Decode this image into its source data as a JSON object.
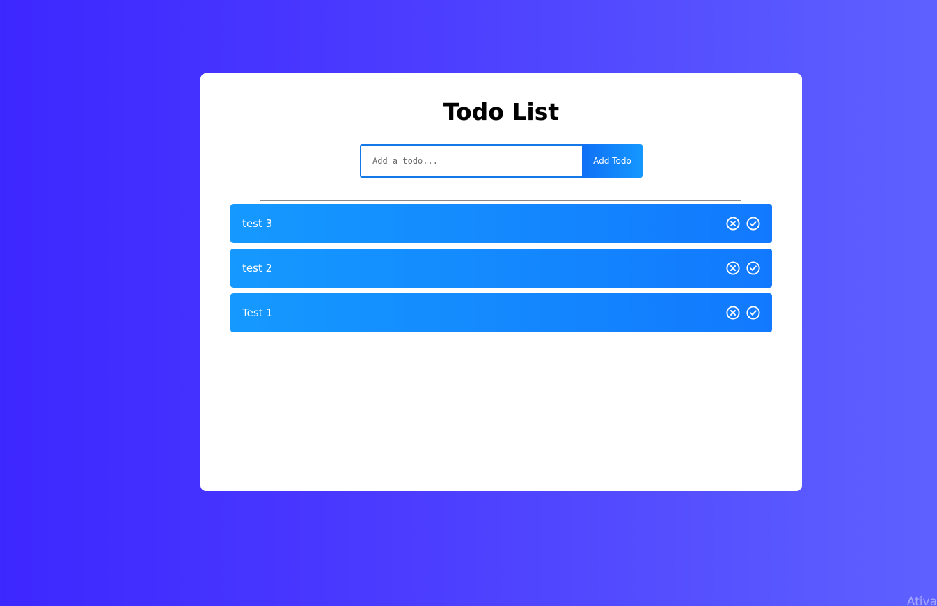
{
  "app": {
    "title": "Todo List"
  },
  "form": {
    "placeholder": "Add a todo...",
    "value": "",
    "button_label": "Add Todo"
  },
  "todos": [
    {
      "text": "test 3",
      "delete_icon": "circle-x-icon",
      "complete_icon": "circle-check-icon"
    },
    {
      "text": "test 2",
      "delete_icon": "circle-x-icon",
      "complete_icon": "circle-check-icon"
    },
    {
      "text": "Test 1",
      "delete_icon": "circle-x-icon",
      "complete_icon": "circle-check-icon"
    }
  ],
  "watermark": "Ativa",
  "colors": {
    "background_start": "#3d27ff",
    "background_end": "#5e61ff",
    "accent": "#1478e8",
    "item_start": "#1599ff",
    "item_end": "#1279fe"
  }
}
